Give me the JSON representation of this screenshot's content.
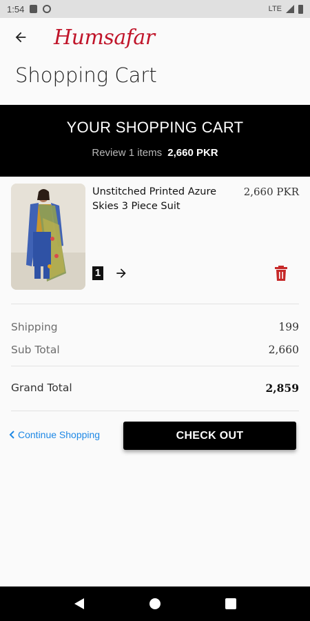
{
  "status_bar": {
    "time": "1:54",
    "network": "LTE"
  },
  "app_bar": {
    "back_icon": "back-arrow-icon",
    "logo_text": "Humsafar"
  },
  "page_title": "Shopping Cart",
  "banner": {
    "title": "YOUR SHOPPING CART",
    "review_text": "Review 1 items",
    "review_total": "2,660 PKR"
  },
  "cart_items": [
    {
      "name": "Unstitched Printed Azure Skies 3 Piece Suit",
      "price": "2,660 PKR",
      "quantity": "1",
      "image_icon": "product-image",
      "next_icon": "arrow-right-icon",
      "delete_icon": "trash-icon"
    }
  ],
  "summary": {
    "shipping_label": "Shipping",
    "shipping_value": "199",
    "subtotal_label": "Sub Total",
    "subtotal_value": "2,660",
    "grand_label": "Grand Total",
    "grand_value": "2,859"
  },
  "actions": {
    "continue_label": "Continue Shopping",
    "checkout_label": "CHECK OUT"
  },
  "colors": {
    "brand_red": "#c0152a",
    "delete_red": "#c62828",
    "link_blue": "#1e88e5",
    "banner_bg": "#000000"
  }
}
